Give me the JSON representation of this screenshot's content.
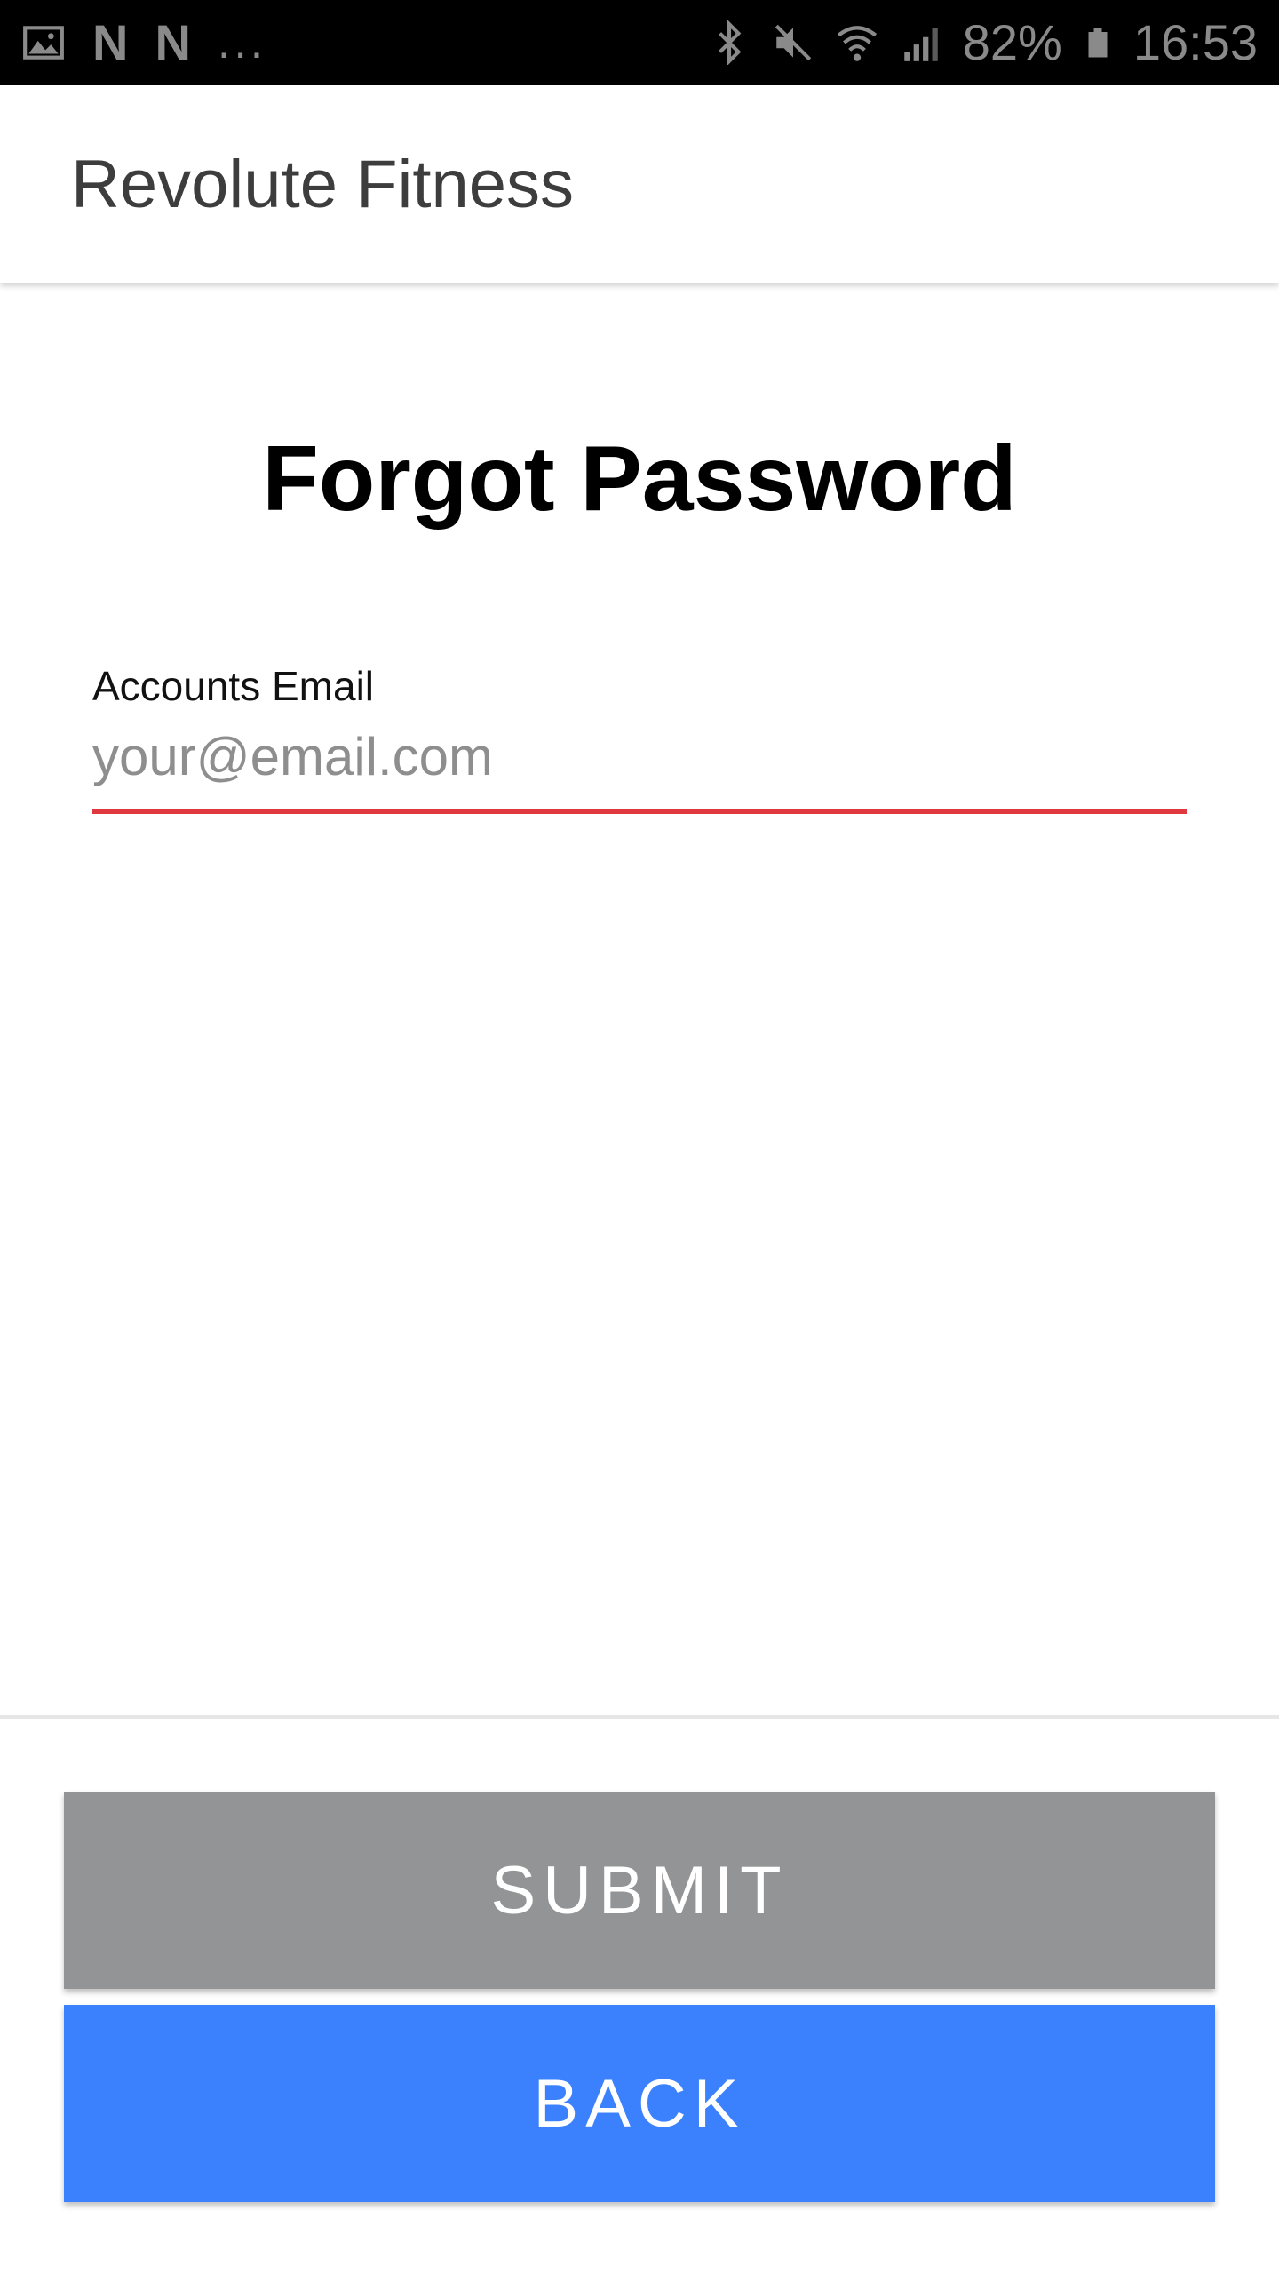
{
  "status_bar": {
    "left_icons": [
      "image-icon",
      "n-notification-icon",
      "n-notification-icon"
    ],
    "n_glyph": "N",
    "overflow": "...",
    "right_icons": [
      "bluetooth-icon",
      "mute-icon",
      "wifi-icon",
      "signal-icon",
      "battery-icon"
    ],
    "battery_percent": "82%",
    "time": "16:53"
  },
  "app_bar": {
    "title": "Revolute Fitness"
  },
  "main": {
    "title": "Forgot Password",
    "email_field": {
      "label": "Accounts Email",
      "value": "",
      "placeholder": "your@email.com"
    }
  },
  "buttons": {
    "submit_label": "SUBMIT",
    "back_label": "BACK"
  },
  "colors": {
    "status_bar_bg": "#000000",
    "input_underline": "#e0383e",
    "submit_bg": "#939495",
    "back_bg": "#3b80fc"
  }
}
